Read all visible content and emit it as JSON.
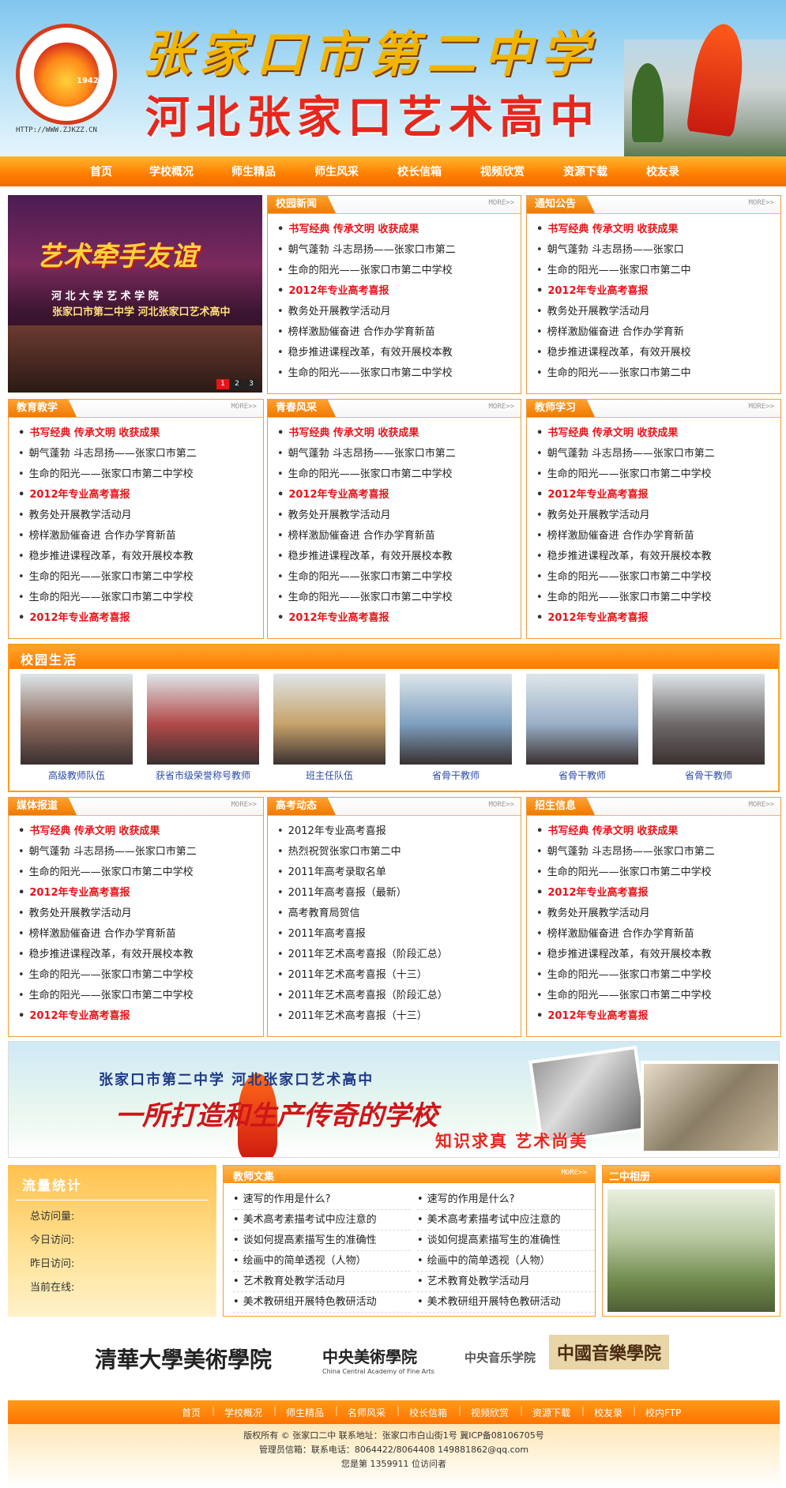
{
  "header": {
    "title_cn": "张家口市第二中学",
    "subtitle_cn": "河北张家口艺术高中",
    "logo_year": "1942",
    "logo_url": "HTTP://WWW.ZJKZZ.CN"
  },
  "nav": [
    "首页",
    "学校概况",
    "师生精品",
    "师生风采",
    "校长信箱",
    "视频欣赏",
    "资源下载",
    "校友录"
  ],
  "slideshow": {
    "sign": "艺术牵手友谊",
    "line1": "河 北 大 学 艺 术 学 院",
    "line2": "张家口市第二中学 河北张家口艺术高中",
    "pages": [
      "1",
      "2",
      "3"
    ]
  },
  "more_label": "MORE>>",
  "boxes": {
    "campus_news": {
      "title": "校园新闻",
      "items": [
        "书写经典 传承文明 收获成果",
        "朝气蓬勃 斗志昂扬——张家口市第二",
        "生命的阳光——张家口市第二中学校",
        "2012年专业高考喜报",
        "教务处开展教学活动月",
        "榜样激励催奋进 合作办学育新苗",
        "稳步推进课程改革，有效开展校本教",
        "生命的阳光——张家口市第二中学校"
      ]
    },
    "notice": {
      "title": "通知公告",
      "items": [
        "书写经典 传承文明 收获成果",
        "朝气蓬勃 斗志昂扬——张家口",
        "生命的阳光——张家口市第二中",
        "2012年专业高考喜报",
        "教务处开展教学活动月",
        "榜样激励催奋进 合作办学育新",
        "稳步推进课程改革，有效开展校",
        "生命的阳光——张家口市第二中"
      ]
    },
    "education": {
      "title": "教育教学",
      "items": [
        "书写经典 传承文明 收获成果",
        "朝气蓬勃 斗志昂扬——张家口市第二",
        "生命的阳光——张家口市第二中学校",
        "2012年专业高考喜报",
        "教务处开展教学活动月",
        "榜样激励催奋进 合作办学育新苗",
        "稳步推进课程改革，有效开展校本教",
        "生命的阳光——张家口市第二中学校",
        "生命的阳光——张家口市第二中学校",
        "2012年专业高考喜报"
      ]
    },
    "youth": {
      "title": "青春风采",
      "items": [
        "书写经典 传承文明 收获成果",
        "朝气蓬勃 斗志昂扬——张家口市第二",
        "生命的阳光——张家口市第二中学校",
        "2012年专业高考喜报",
        "教务处开展教学活动月",
        "榜样激励催奋进 合作办学育新苗",
        "稳步推进课程改革，有效开展校本教",
        "生命的阳光——张家口市第二中学校",
        "生命的阳光——张家口市第二中学校",
        "2012年专业高考喜报"
      ]
    },
    "teacher_study": {
      "title": "教师学习",
      "items": [
        "书写经典 传承文明 收获成果",
        "朝气蓬勃 斗志昂扬——张家口市第二",
        "生命的阳光——张家口市第二中学校",
        "2012年专业高考喜报",
        "教务处开展教学活动月",
        "榜样激励催奋进 合作办学育新苗",
        "稳步推进课程改革，有效开展校本教",
        "生命的阳光——张家口市第二中学校",
        "生命的阳光——张家口市第二中学校",
        "2012年专业高考喜报"
      ]
    },
    "media": {
      "title": "媒体报道",
      "items": [
        "书写经典 传承文明 收获成果",
        "朝气蓬勃 斗志昂扬——张家口市第二",
        "生命的阳光——张家口市第二中学校",
        "2012年专业高考喜报",
        "教务处开展教学活动月",
        "榜样激励催奋进 合作办学育新苗",
        "稳步推进课程改革，有效开展校本教",
        "生命的阳光——张家口市第二中学校",
        "生命的阳光——张家口市第二中学校",
        "2012年专业高考喜报"
      ]
    },
    "gaokao": {
      "title": "高考动态",
      "items": [
        "2012年专业高考喜报",
        "热烈祝贺张家口市第二中",
        "2011年高考录取名单",
        "2011年高考喜报（最新）",
        "高考教育局贺信",
        "2011年高考喜报",
        "2011年艺术高考喜报（阶段汇总）",
        "2011年艺术高考喜报（十三）",
        "2011年艺术高考喜报（阶段汇总）",
        "2011年艺术高考喜报（十三）"
      ]
    },
    "enroll": {
      "title": "招生信息",
      "items": [
        "书写经典 传承文明 收获成果",
        "朝气蓬勃 斗志昂扬——张家口市第二",
        "生命的阳光——张家口市第二中学校",
        "2012年专业高考喜报",
        "教务处开展教学活动月",
        "榜样激励催奋进 合作办学育新苗",
        "稳步推进课程改革，有效开展校本教",
        "生命的阳光——张家口市第二中学校",
        "生命的阳光——张家口市第二中学校",
        "2012年专业高考喜报"
      ]
    }
  },
  "school_life": {
    "title": "校园生活",
    "photos": [
      {
        "caption": "高级教师队伍",
        "color": "#8d6a5c"
      },
      {
        "caption": "获省市级荣誉称号教师",
        "color": "#b34a4a"
      },
      {
        "caption": "班主任队伍",
        "color": "#c7a36a"
      },
      {
        "caption": "省骨干教师",
        "color": "#7fa0c0"
      },
      {
        "caption": "省骨干教师",
        "color": "#9ab0c8"
      },
      {
        "caption": "省骨干教师",
        "color": "#6f6a6a"
      }
    ]
  },
  "ad": {
    "line1": "张家口市第二中学  河北张家口艺术高中",
    "line2": "一所打造和生产传奇的学校",
    "line3": "知识求真    艺术尚美"
  },
  "stats": {
    "title": "流量统计",
    "lines": [
      "总访问量:",
      "今日访问:",
      "昨日访问:",
      "当前在线:"
    ]
  },
  "essay": {
    "title": "教师文集",
    "left": [
      "速写的作用是什么?",
      "美术高考素描考试中应注意的",
      "谈如何提高素描写生的准确性",
      "绘画中的简单透视（人物）",
      "艺术教育处教学活动月",
      "美术教研组开展特色教研活动"
    ],
    "right": [
      "速写的作用是什么?",
      "美术高考素描考试中应注意的",
      "谈如何提高素描写生的准确性",
      "绘画中的简单透视（人物）",
      "艺术教育处教学活动月",
      "美术教研组开展特色教研活动"
    ]
  },
  "album": {
    "title": "二中相册"
  },
  "partner_logos": [
    "清華大學美術學院",
    "中央美術學院",
    "China Central Academy of Fine Arts",
    "中央音乐学院",
    "中國音樂學院"
  ],
  "footer_nav": [
    "首页",
    "学校概况",
    "师生精品",
    "名师风采",
    "校长信箱",
    "视频欣赏",
    "资源下载",
    "校友录",
    "校内FTP"
  ],
  "footer": {
    "line1": "版权所有 © 张家口二中           联系地址：张家口市白山街1号  冀ICP备08106705号",
    "line2": "管理员信箱：联系电话：8064422/8064408  149881862@qq.com",
    "line3": "您是第 1359911 位访问者"
  },
  "colors": {
    "accent": "#ff7e00",
    "headline_red": "#e8141a",
    "link_blue": "#2a4aa8"
  }
}
